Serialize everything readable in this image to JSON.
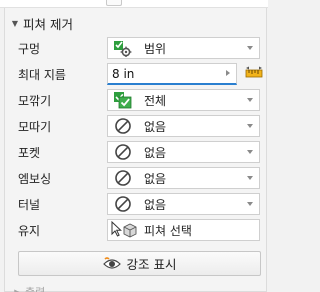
{
  "section": {
    "title": "피쳐 제거",
    "expanded": true
  },
  "rows": {
    "hole": {
      "label": "구멍",
      "value": "범위",
      "icon": "hole-range-icon"
    },
    "max_size": {
      "label": "최대 지름",
      "value": "8 in",
      "icon": "ruler-icon"
    },
    "fillet": {
      "label": "모깎기",
      "value": "전체",
      "icon": "fillet-all-icon"
    },
    "chamfer": {
      "label": "모따기",
      "value": "없음",
      "icon": "none-icon"
    },
    "pocket": {
      "label": "포켓",
      "value": "없음",
      "icon": "none-icon"
    },
    "emboss": {
      "label": "엠보싱",
      "value": "없음",
      "icon": "none-icon"
    },
    "tunnel": {
      "label": "터널",
      "value": "없음",
      "icon": "none-icon"
    },
    "keep": {
      "label": "유지",
      "value": "피쳐 선택",
      "icon": "select-cursor-icon"
    }
  },
  "highlight_button": {
    "label": "강조 표시",
    "icon": "eye-icon"
  },
  "footer": {
    "title": "출력",
    "expanded": false
  },
  "colors": {
    "accent": "#2a7fd0",
    "feature_green": "#2e9e3e"
  }
}
